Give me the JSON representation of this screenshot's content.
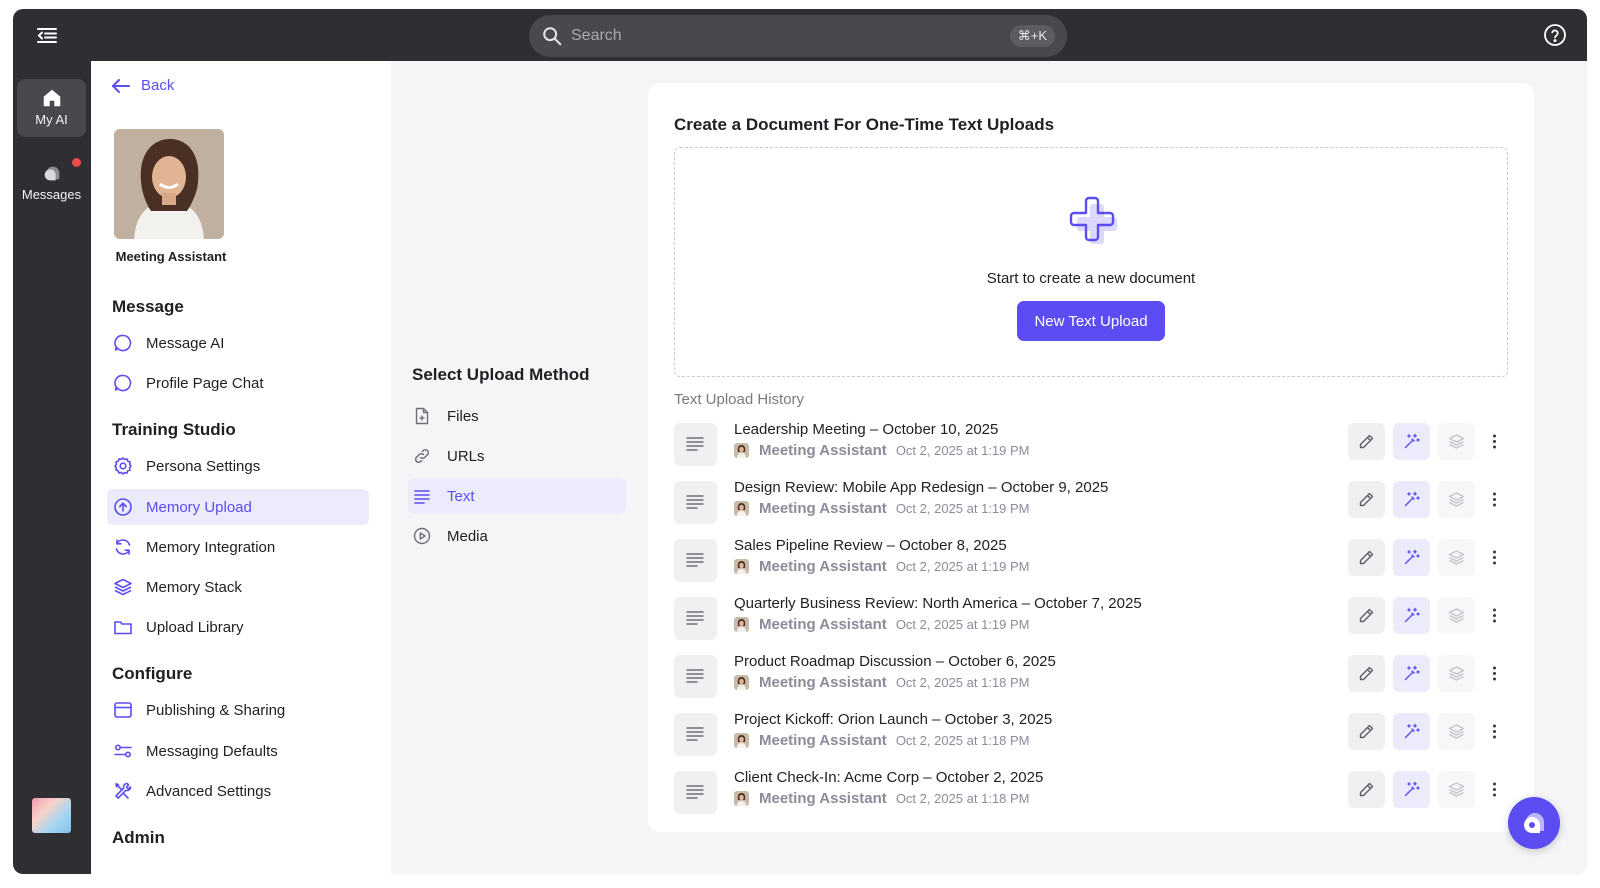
{
  "topbar": {
    "search_placeholder": "Search",
    "shortcut": "⌘+K"
  },
  "rail": {
    "items": [
      {
        "label": "My AI",
        "icon": "home-icon"
      },
      {
        "label": "Messages",
        "icon": "chat-bubble-icon"
      }
    ]
  },
  "sidebar": {
    "back_label": "Back",
    "persona_name": "Meeting Assistant",
    "sections": {
      "message": "Message",
      "training": "Training Studio",
      "configure": "Configure",
      "admin": "Admin"
    },
    "items": {
      "message_ai": "Message AI",
      "profile_page_chat": "Profile Page Chat",
      "persona_settings": "Persona Settings",
      "memory_upload": "Memory Upload",
      "memory_integration": "Memory Integration",
      "memory_stack": "Memory Stack",
      "upload_library": "Upload Library",
      "publishing_sharing": "Publishing & Sharing",
      "messaging_defaults": "Messaging Defaults",
      "advanced_settings": "Advanced Settings"
    }
  },
  "methods": {
    "title": "Select Upload Method",
    "items": {
      "files": "Files",
      "urls": "URLs",
      "text": "Text",
      "media": "Media"
    },
    "selected": "Text"
  },
  "panel": {
    "title": "Create a Document For One-Time Text Uploads",
    "dropzone_text": "Start to create a new document",
    "new_button": "New Text Upload",
    "history_title": "Text Upload History"
  },
  "history": [
    {
      "title": "Leadership Meeting – October 10, 2025",
      "author": "Meeting Assistant",
      "date": "Oct 2, 2025 at 1:19 PM"
    },
    {
      "title": "Design Review: Mobile App Redesign – October 9, 2025",
      "author": "Meeting Assistant",
      "date": "Oct 2, 2025 at 1:19 PM"
    },
    {
      "title": "Sales Pipeline Review – October 8, 2025",
      "author": "Meeting Assistant",
      "date": "Oct 2, 2025 at 1:19 PM"
    },
    {
      "title": "Quarterly Business Review: North America – October 7, 2025",
      "author": "Meeting Assistant",
      "date": "Oct 2, 2025 at 1:19 PM"
    },
    {
      "title": "Product Roadmap Discussion – October 6, 2025",
      "author": "Meeting Assistant",
      "date": "Oct 2, 2025 at 1:18 PM"
    },
    {
      "title": "Project Kickoff: Orion Launch – October 3, 2025",
      "author": "Meeting Assistant",
      "date": "Oct 2, 2025 at 1:18 PM"
    },
    {
      "title": "Client Check-In: Acme Corp – October 2, 2025",
      "author": "Meeting Assistant",
      "date": "Oct 2, 2025 at 1:18 PM"
    }
  ],
  "colors": {
    "accent": "#5b4df2",
    "accent_soft": "#ecebfb",
    "dark_bar": "#2f2f33",
    "notification": "#f04b4b"
  }
}
